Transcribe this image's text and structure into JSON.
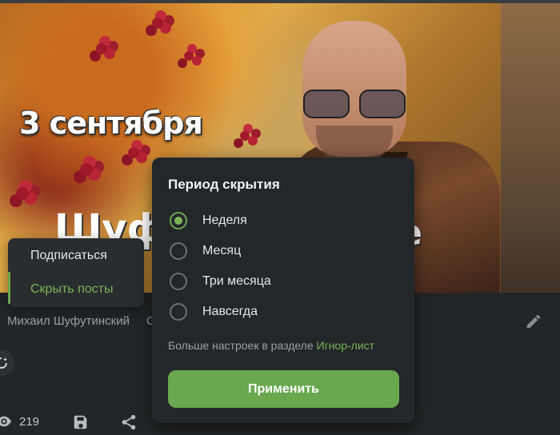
{
  "post_image": {
    "caption_date": "3 сентября",
    "caption_name_left": "Шуф",
    "caption_name_right": "е"
  },
  "context_menu": {
    "items": [
      {
        "label": "Подписаться"
      },
      {
        "label": "Скрыть посты"
      }
    ]
  },
  "post": {
    "author": "Михаил Шуфутинский",
    "author_extra": "С",
    "views": "219"
  },
  "hide_dialog": {
    "title": "Период скрытия",
    "options": [
      {
        "label": "Неделя",
        "selected": true
      },
      {
        "label": "Месяц",
        "selected": false
      },
      {
        "label": "Три месяца",
        "selected": false
      },
      {
        "label": "Навсегда",
        "selected": false
      }
    ],
    "more_text": "Больше настроек в разделе",
    "more_link": "Игнор-лист",
    "apply_label": "Применить"
  },
  "colors": {
    "accent": "#6aa84f",
    "background": "#232628",
    "panel": "#24272a"
  }
}
